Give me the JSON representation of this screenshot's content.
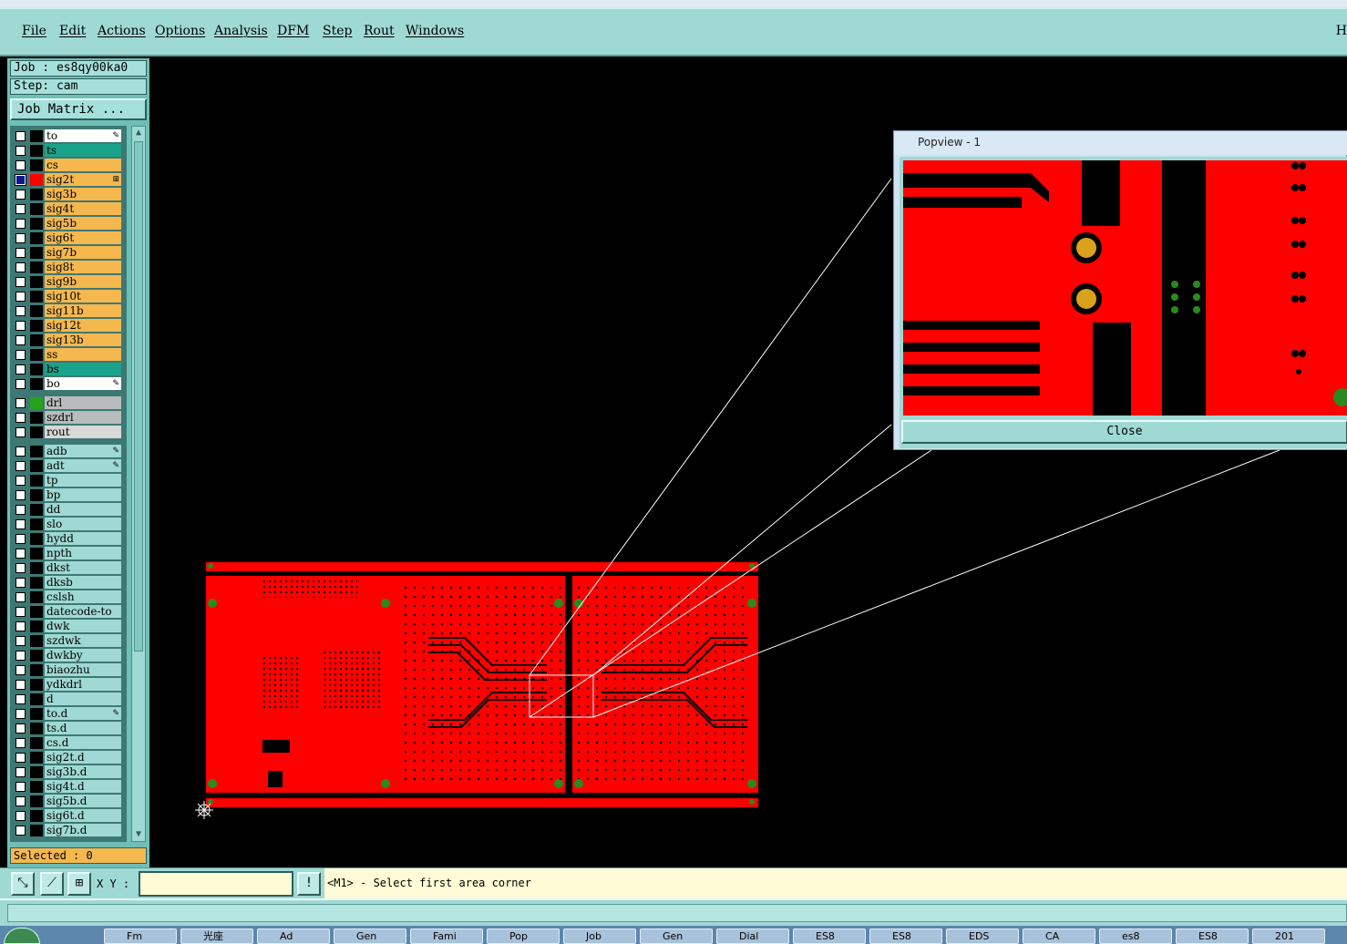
{
  "menu": {
    "items": [
      "File",
      "Edit",
      "Actions",
      "Options",
      "Analysis",
      "DFM",
      "Step",
      "Rout",
      "Windows"
    ],
    "right_letter": "H"
  },
  "job": {
    "job_text": "Job : es8qy00ka0",
    "step_text": "Step: cam",
    "matrix_label": "Job Matrix ..."
  },
  "layers": {
    "board": [
      {
        "name": "to",
        "color": "#ffffff",
        "icon": "✎"
      },
      {
        "name": "ts",
        "color": "#1aa38a",
        "icon": ""
      },
      {
        "name": "cs",
        "color": "#f5b84f",
        "icon": ""
      },
      {
        "name": "sig2t",
        "color": "#f5b84f",
        "icon": "⊞",
        "active": true
      },
      {
        "name": "sig3b",
        "color": "#f5b84f",
        "icon": ""
      },
      {
        "name": "sig4t",
        "color": "#f5b84f",
        "icon": ""
      },
      {
        "name": "sig5b",
        "color": "#f5b84f",
        "icon": ""
      },
      {
        "name": "sig6t",
        "color": "#f5b84f",
        "icon": ""
      },
      {
        "name": "sig7b",
        "color": "#f5b84f",
        "icon": ""
      },
      {
        "name": "sig8t",
        "color": "#f5b84f",
        "icon": ""
      },
      {
        "name": "sig9b",
        "color": "#f5b84f",
        "icon": ""
      },
      {
        "name": "sig10t",
        "color": "#f5b84f",
        "icon": ""
      },
      {
        "name": "sig11b",
        "color": "#f5b84f",
        "icon": ""
      },
      {
        "name": "sig12t",
        "color": "#f5b84f",
        "icon": ""
      },
      {
        "name": "sig13b",
        "color": "#f5b84f",
        "icon": ""
      },
      {
        "name": "ss",
        "color": "#f5b84f",
        "icon": ""
      },
      {
        "name": "bs",
        "color": "#1aa38a",
        "icon": ""
      },
      {
        "name": "bo",
        "color": "#ffffff",
        "icon": "✎"
      }
    ],
    "drill": [
      {
        "name": "drl",
        "color": "#b9bcbc",
        "swatch": "#27a21c"
      },
      {
        "name": "szdrl",
        "color": "#b9bcbc"
      },
      {
        "name": "rout",
        "color": "#d8d8d8"
      }
    ],
    "misc": [
      {
        "name": "adb",
        "icon": "✎"
      },
      {
        "name": "adt",
        "icon": "✎"
      },
      {
        "name": "tp"
      },
      {
        "name": "bp"
      },
      {
        "name": "dd"
      },
      {
        "name": "slo"
      },
      {
        "name": "hydd"
      },
      {
        "name": "npth"
      },
      {
        "name": "dkst"
      },
      {
        "name": "dksb"
      },
      {
        "name": "cslsh"
      },
      {
        "name": "datecode-to"
      },
      {
        "name": "dwk"
      },
      {
        "name": "szdwk"
      },
      {
        "name": "dwkby"
      },
      {
        "name": "biaozhu"
      },
      {
        "name": "ydkdrl"
      },
      {
        "name": "d"
      },
      {
        "name": "to.d",
        "icon": "✎"
      },
      {
        "name": "ts.d"
      },
      {
        "name": "cs.d"
      },
      {
        "name": "sig2t.d"
      },
      {
        "name": "sig3b.d"
      },
      {
        "name": "sig4t.d"
      },
      {
        "name": "sig5b.d"
      },
      {
        "name": "sig6t.d"
      },
      {
        "name": "sig7b.d"
      }
    ],
    "misc_color": "#9fd9d3"
  },
  "selected_text": "Selected : 0",
  "status": {
    "xy_label": "X Y :",
    "xy_value": "",
    "message": "<M1> - Select first area corner",
    "alert_icon": "!"
  },
  "popview": {
    "title": "Popview - 1",
    "close_label": "Close"
  },
  "taskbar": {
    "items": [
      "Fm",
      "光座",
      "Ad",
      "Gen",
      "Fami",
      "Pop",
      "Job",
      "Gen",
      "Dial",
      "ES8",
      "ES8",
      "EDS",
      "CA",
      "es8",
      "ES8",
      "201"
    ]
  },
  "colors": {
    "copper": "#ff0000",
    "menu_bg": "#9fd9d3",
    "active_layer": "#ff0000"
  },
  "icons": [
    "snap-icon",
    "measure-icon",
    "grid-icon",
    "alert-icon",
    "origin-crosshair-icon",
    "edit-pencil-icon"
  ]
}
